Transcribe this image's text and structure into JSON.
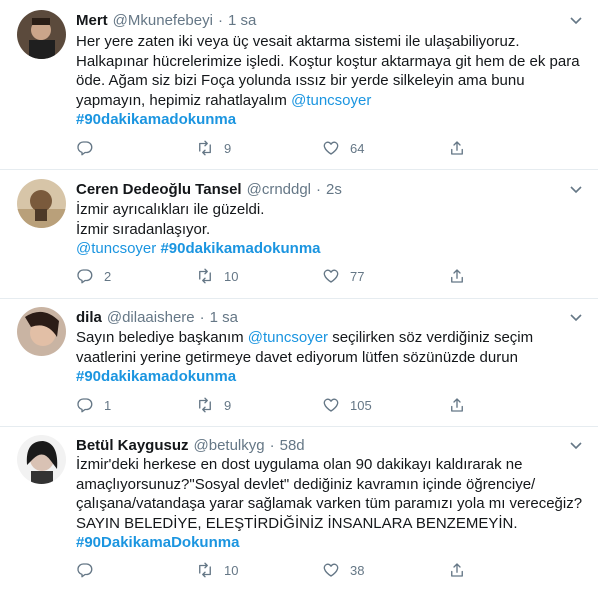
{
  "tweets": [
    {
      "name": "Mert",
      "handle": "@Mkunefebeyi",
      "dot": "·",
      "time": "1 sa",
      "lines": [
        {
          "text": "Her yere zaten iki veya üç vesait aktarma sistemi ile ulaşabiliyoruz."
        },
        {
          "text": "Halkapınar hücrelerimize işledi. Koştur koştur aktarmaya git hem de ek para"
        },
        {
          "text": "öde.  Ağam siz bizi Foça yolunda ıssız bir yerde silkeleyin ama bunu"
        },
        {
          "text": "yapmayın, hepimiz rahatlayalım ",
          "mention": "@tuncsoyer"
        },
        {
          "hashtag": "#90dakikamadokunma"
        }
      ],
      "replies": "",
      "retweets": "9",
      "likes": "64"
    },
    {
      "name": "Ceren Dedeoğlu Tansel",
      "handle": "@crnddgl",
      "dot": "·",
      "time": "2s",
      "lines": [
        {
          "text": "İzmir ayrıcalıkları ile güzeldi."
        },
        {
          "text": "İzmir sıradanlaşıyor."
        },
        {
          "mention": "@tuncsoyer",
          "hashtag": "#90dakikamadokunma"
        }
      ],
      "replies": "2",
      "retweets": "10",
      "likes": "77"
    },
    {
      "name": "dila",
      "handle": "@dilaaishere",
      "dot": "·",
      "time": "1 sa",
      "lines": [
        {
          "text": "Sayın belediye başkanım ",
          "mention": "@tuncsoyer",
          "tail": " seçilirken söz verdiğiniz seçim"
        },
        {
          "text": "vaatlerini yerine getirmeye davet ediyorum lütfen sözünüzde durun"
        },
        {
          "hashtag": "#90dakikamadokunma"
        }
      ],
      "replies": "1",
      "retweets": "9",
      "likes": "105"
    },
    {
      "name": "Betül Kaygusuz",
      "handle": "@betulkyg",
      "dot": "·",
      "time": "58d",
      "lines": [
        {
          "text": "İzmir'deki herkese en dost uygulama olan 90 dakikayı kaldırarak ne"
        },
        {
          "text": "amaçlıyorsunuz?\"Sosyal devlet\" dediğiniz kavramın içinde öğrenciye/"
        },
        {
          "text": "çalışana/vatandaşa yarar sağlamak varken tüm paramızı yola mı vereceğiz?"
        },
        {
          "text": "SAYIN BELEDİYE, ELEŞTİRDİĞİNİZ İNSANLARA BENZEMEYİN."
        },
        {
          "hashtag": "#90DakikamaDokunma"
        }
      ],
      "replies": "",
      "retweets": "10",
      "likes": "38"
    }
  ],
  "icons": {
    "reply": "reply-icon",
    "retweet": "retweet-icon",
    "like": "like-icon",
    "share": "share-icon",
    "caret": "chevron-down-icon"
  },
  "colors": {
    "link": "#1b95e0",
    "muted": "#657786",
    "text": "#14171a",
    "divider": "#e6ecf0"
  }
}
